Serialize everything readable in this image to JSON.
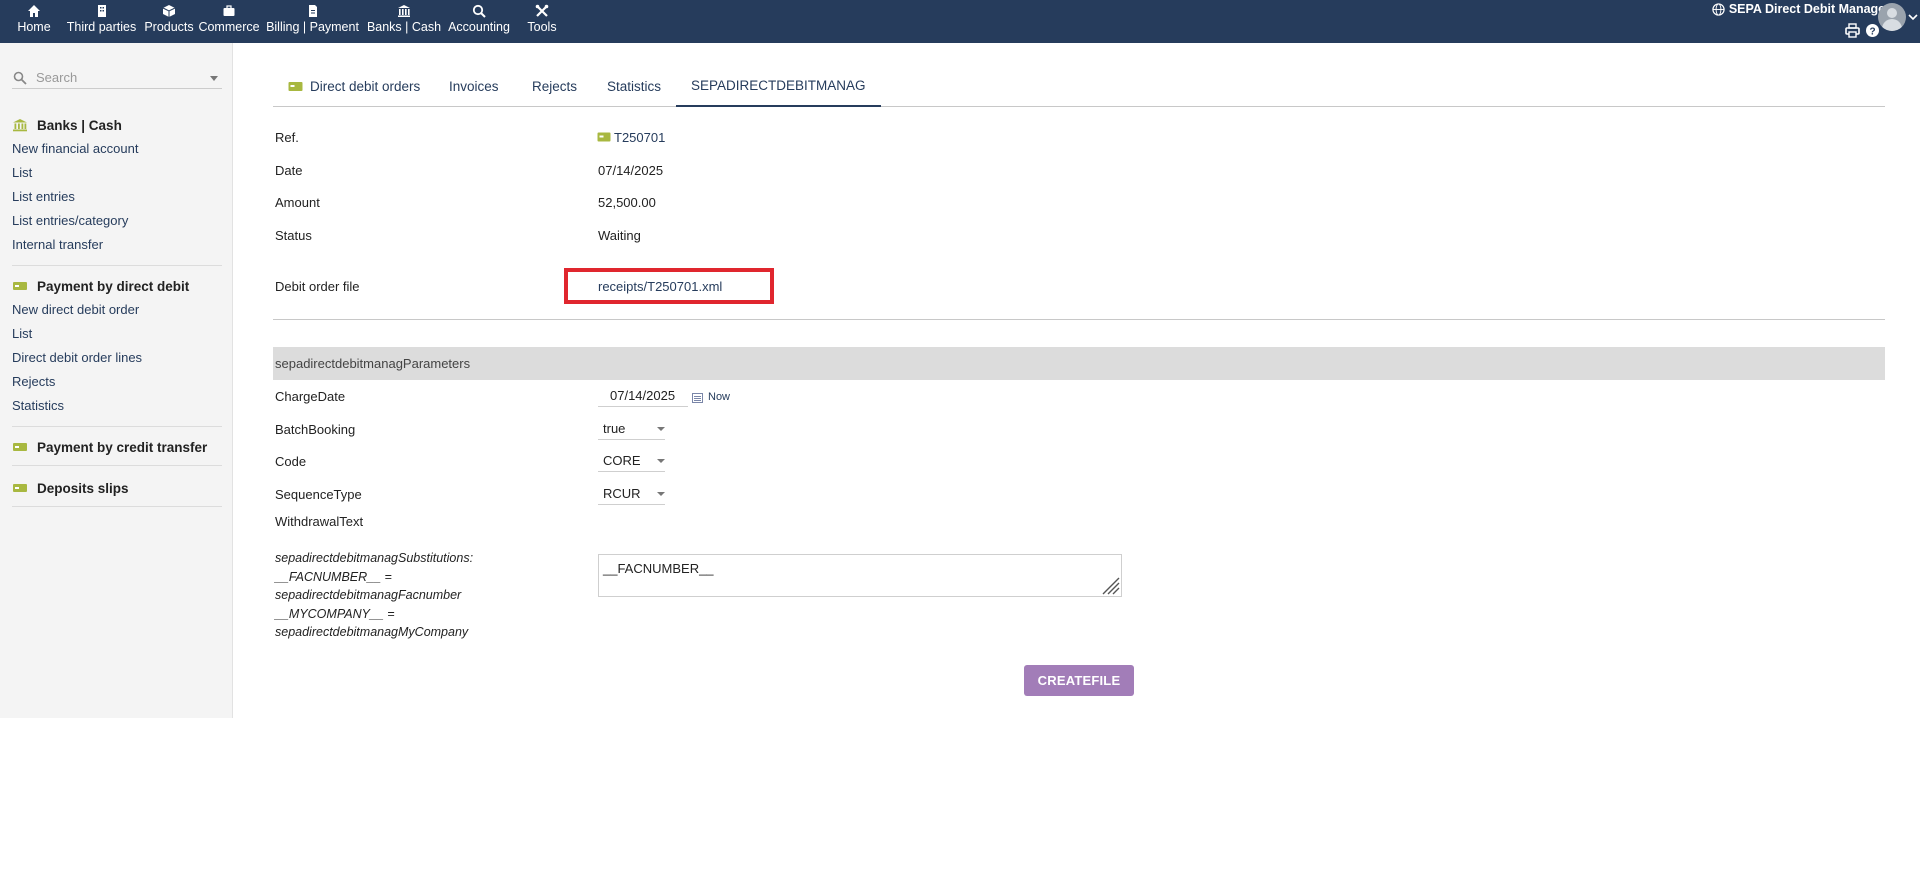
{
  "topnav": {
    "items": [
      {
        "label": "Home",
        "icon": "home-icon"
      },
      {
        "label": "Third parties",
        "icon": "building-icon"
      },
      {
        "label": "Products",
        "icon": "cube-icon"
      },
      {
        "label": "Commerce",
        "icon": "briefcase-icon"
      },
      {
        "label": "Billing | Payment",
        "icon": "invoice-icon"
      },
      {
        "label": "Banks | Cash",
        "icon": "bank-icon"
      },
      {
        "label": "Accounting",
        "icon": "search-dollar-icon"
      },
      {
        "label": "Tools",
        "icon": "tools-icon"
      }
    ],
    "active_index": 5,
    "module_title": "SEPA Direct Debit Manager"
  },
  "sidebar": {
    "search_placeholder": "Search",
    "groups": [
      {
        "title": "Banks | Cash",
        "icon": "bank-icon",
        "links": [
          "New financial account",
          "List",
          "List entries",
          "List entries/category",
          "Internal transfer"
        ]
      },
      {
        "title": "Payment by direct debit",
        "icon": "payment-icon",
        "links": [
          "New direct debit order",
          "List",
          "Direct debit order lines",
          "Rejects",
          "Statistics"
        ]
      },
      {
        "title": "Payment by credit transfer",
        "icon": "payment-icon",
        "links": []
      },
      {
        "title": "Deposits slips",
        "icon": "payment-icon",
        "links": []
      }
    ]
  },
  "tabs": [
    {
      "label": "Direct debit orders"
    },
    {
      "label": "Invoices"
    },
    {
      "label": "Rejects"
    },
    {
      "label": "Statistics"
    },
    {
      "label": "SEPADIRECTDEBITMANAG"
    }
  ],
  "card": {
    "ref_label": "Ref.",
    "ref_value": "T250701",
    "date_label": "Date",
    "date_value": "07/14/2025",
    "amount_label": "Amount",
    "amount_value": "52,500.00",
    "status_label": "Status",
    "status_value": "Waiting",
    "file_label": "Debit order file",
    "file_value": "receipts/T250701.xml"
  },
  "params": {
    "section_title": "sepadirectdebitmanagParameters",
    "charge_date_label": "ChargeDate",
    "charge_date_value": "07/14/2025",
    "now_label": "Now",
    "batch_label": "BatchBooking",
    "batch_value": "true",
    "code_label": "Code",
    "code_value": "CORE",
    "seq_label": "SequenceType",
    "seq_value": "RCUR",
    "withdrawal_label": "WithdrawalText",
    "subst_lines": [
      "sepadirectdebitmanagSubstitutions:",
      "__FACNUMBER__ =",
      "sepadirectdebitmanagFacnumber",
      "__MYCOMPANY__ =",
      "sepadirectdebitmanagMyCompany"
    ],
    "withdrawal_value": "__FACNUMBER__",
    "create_button": "CREATEFILE"
  },
  "colors": {
    "topbar": "#263c5c",
    "link": "#263c5c",
    "highlight": "#e0262e",
    "button": "#a27db8",
    "icon_green": "#a8b840"
  }
}
